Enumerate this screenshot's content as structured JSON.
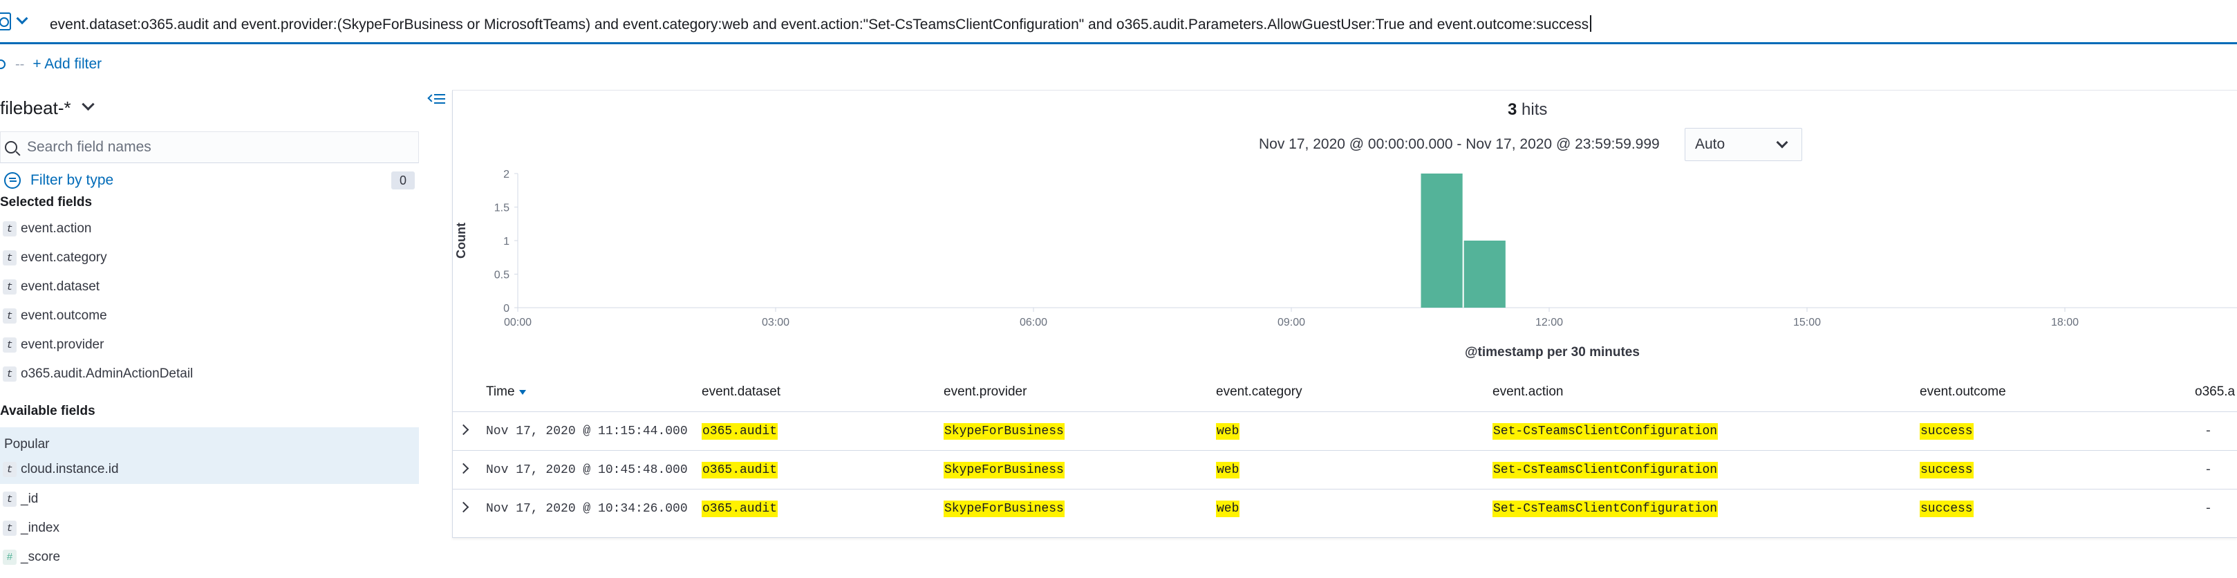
{
  "query": {
    "text": "event.dataset:o365.audit and event.provider:(SkypeForBusiness or MicrosoftTeams) and event.category:web and event.action:\"Set-CsTeamsClientConfiguration\" and o365.audit.Parameters.AllowGuestUser:True and event.outcome:success"
  },
  "filters": {
    "add_filter_label": "+ Add filter",
    "dash": "--"
  },
  "sidebar": {
    "index_pattern": "filebeat-*",
    "search_placeholder": "Search field names",
    "filter_by_type_label": "Filter by type",
    "filter_count": "0",
    "selected_title": "Selected fields",
    "selected_fields": [
      {
        "type": "t",
        "name": "event.action"
      },
      {
        "type": "t",
        "name": "event.category"
      },
      {
        "type": "t",
        "name": "event.dataset"
      },
      {
        "type": "t",
        "name": "event.outcome"
      },
      {
        "type": "t",
        "name": "event.provider"
      },
      {
        "type": "t",
        "name": "o365.audit.AdminActionDetail"
      }
    ],
    "available_title": "Available fields",
    "popular_label": "Popular",
    "popular_fields": [
      {
        "type": "t",
        "name": "cloud.instance.id"
      }
    ],
    "available_fields": [
      {
        "type": "t",
        "name": "_id"
      },
      {
        "type": "t",
        "name": "_index"
      },
      {
        "type": "#",
        "name": "_score"
      }
    ]
  },
  "results": {
    "hits_count": "3",
    "hits_label": "hits",
    "time_range": "Nov 17, 2020 @ 00:00:00.000 - Nov 17, 2020 @ 23:59:59.999",
    "interval": "Auto",
    "x_axis_title": "@timestamp per 30 minutes"
  },
  "chart_data": {
    "type": "bar",
    "title": "",
    "xlabel": "@timestamp per 30 minutes",
    "ylabel": "Count",
    "x_ticks": [
      "00:00",
      "03:00",
      "06:00",
      "09:00",
      "12:00",
      "15:00",
      "18:00"
    ],
    "y_ticks": [
      "0",
      "0.5",
      "1",
      "1.5",
      "2"
    ],
    "ylim": [
      0,
      2
    ],
    "bar_color": "#54b399",
    "bars": [
      {
        "x": "10:30",
        "value": 2
      },
      {
        "x": "11:00",
        "value": 1
      }
    ]
  },
  "table": {
    "columns": [
      "Time",
      "event.dataset",
      "event.provider",
      "event.category",
      "event.action",
      "event.outcome",
      "o365.a"
    ],
    "rows": [
      {
        "time": "Nov 17, 2020 @ 11:15:44.000",
        "dataset": "o365.audit",
        "provider": "SkypeForBusiness",
        "category": "web",
        "action": "Set-CsTeamsClientConfiguration",
        "outcome": "success",
        "detail": "-"
      },
      {
        "time": "Nov 17, 2020 @ 10:45:48.000",
        "dataset": "o365.audit",
        "provider": "SkypeForBusiness",
        "category": "web",
        "action": "Set-CsTeamsClientConfiguration",
        "outcome": "success",
        "detail": "-"
      },
      {
        "time": "Nov 17, 2020 @ 10:34:26.000",
        "dataset": "o365.audit",
        "provider": "SkypeForBusiness",
        "category": "web",
        "action": "Set-CsTeamsClientConfiguration",
        "outcome": "success",
        "detail": "-"
      }
    ]
  },
  "colors": {
    "accent": "#006bb8",
    "bar": "#54b399",
    "highlight": "#fff200"
  }
}
